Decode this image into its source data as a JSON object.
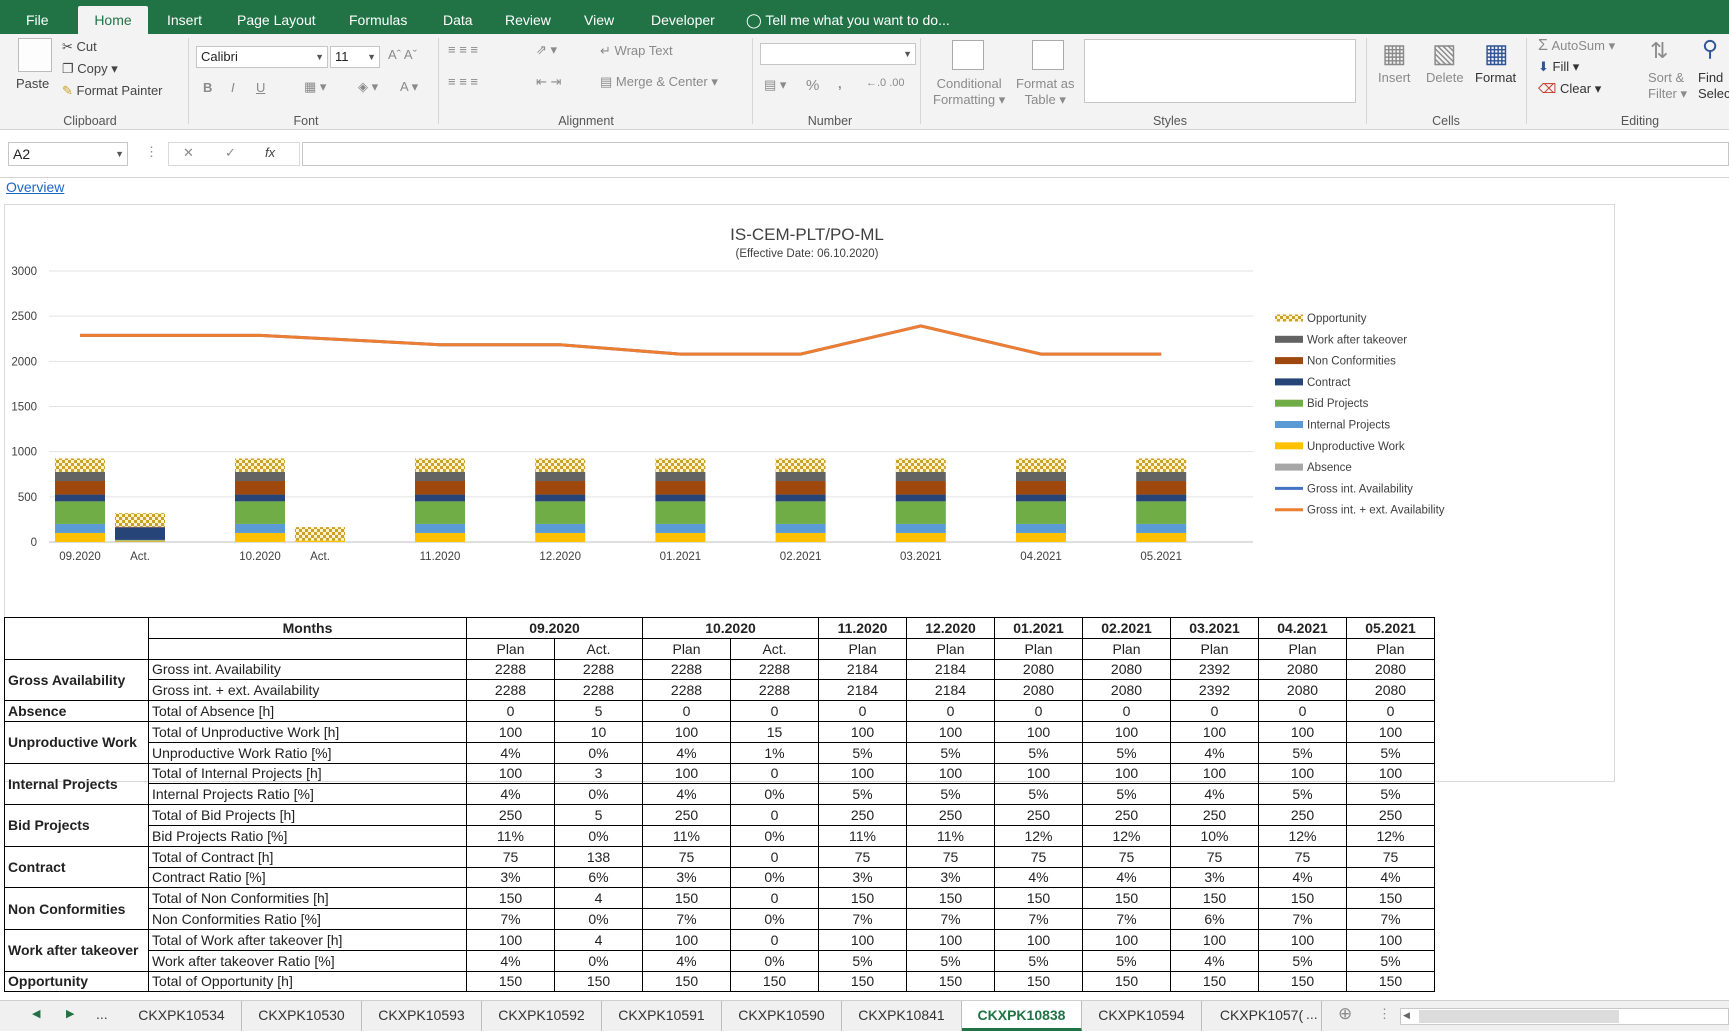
{
  "ribbon": {
    "tabs": [
      "File",
      "Home",
      "Insert",
      "Page Layout",
      "Formulas",
      "Data",
      "Review",
      "View",
      "Developer"
    ],
    "tell_me": "Tell me what you want to do...",
    "clipboard": {
      "paste": "Paste",
      "cut": "Cut",
      "copy": "Copy",
      "format_painter": "Format Painter",
      "label": "Clipboard"
    },
    "font": {
      "name": "Calibri",
      "size": "11",
      "label": "Font",
      "bold": "B",
      "italic": "I",
      "underline": "U"
    },
    "alignment": {
      "wrap": "Wrap Text",
      "merge": "Merge & Center",
      "label": "Alignment"
    },
    "number": {
      "format": "",
      "percent": "%",
      "comma": ",",
      "label": "Number"
    },
    "styles": {
      "cond1": "Conditional",
      "cond2": "Formatting",
      "fmt1": "Format as",
      "fmt2": "Table",
      "label": "Styles"
    },
    "cells": {
      "insert": "Insert",
      "delete": "Delete",
      "format": "Format",
      "label": "Cells"
    },
    "editing": {
      "autosum": "AutoSum",
      "fill": "Fill",
      "clear": "Clear",
      "sort1": "Sort &",
      "sort2": "Filter",
      "find1": "Find",
      "find2": "Selec",
      "label": "Editing"
    }
  },
  "formula": {
    "name_box": "A2",
    "fx": "fx",
    "content": ""
  },
  "sheet": {
    "link": "Overview"
  },
  "colors": {
    "accent": "#217346",
    "link": "#1e66c8"
  },
  "chart_data": {
    "type": "bar",
    "title": "IS-CEM-PLT/PO-ML",
    "subtitle": "(Effective Date: 06.10.2020)",
    "ylim": [
      0,
      3000
    ],
    "yticks": [
      0,
      500,
      1000,
      1500,
      2000,
      2500,
      3000
    ],
    "categories": [
      "09.2020",
      "Act.",
      "10.2020",
      "Act.",
      "11.2020",
      "12.2020",
      "01.2021",
      "02.2021",
      "03.2021",
      "04.2021",
      "05.2021"
    ],
    "stacked_series": [
      {
        "name": "Absence",
        "color": "#a6a6a6",
        "values": [
          0,
          5,
          0,
          0,
          0,
          0,
          0,
          0,
          0,
          0,
          0
        ]
      },
      {
        "name": "Unproductive Work",
        "color": "#ffc000",
        "values": [
          100,
          10,
          100,
          15,
          100,
          100,
          100,
          100,
          100,
          100,
          100
        ]
      },
      {
        "name": "Internal Projects",
        "color": "#5b9bd5",
        "values": [
          100,
          3,
          100,
          0,
          100,
          100,
          100,
          100,
          100,
          100,
          100
        ]
      },
      {
        "name": "Bid Projects",
        "color": "#70ad47",
        "values": [
          250,
          5,
          250,
          0,
          250,
          250,
          250,
          250,
          250,
          250,
          250
        ]
      },
      {
        "name": "Contract",
        "color": "#264478",
        "values": [
          75,
          138,
          75,
          0,
          75,
          75,
          75,
          75,
          75,
          75,
          75
        ]
      },
      {
        "name": "Non Conformities",
        "color": "#9e480e",
        "values": [
          150,
          4,
          150,
          0,
          150,
          150,
          150,
          150,
          150,
          150,
          150
        ]
      },
      {
        "name": "Work after takeover",
        "color": "#636363",
        "values": [
          100,
          4,
          100,
          0,
          100,
          100,
          100,
          100,
          100,
          100,
          100
        ]
      },
      {
        "name": "Opportunity",
        "color": "#c9a227",
        "pattern": true,
        "values": [
          150,
          150,
          150,
          150,
          150,
          150,
          150,
          150,
          150,
          150,
          150
        ]
      }
    ],
    "line_series": [
      {
        "name": "Gross int. Availability",
        "color": "#4472c4",
        "values": [
          2288,
          2288,
          2288,
          2288,
          2184,
          2184,
          2080,
          2080,
          2392,
          2080,
          2080
        ]
      },
      {
        "name": "Gross int. + ext. Availability",
        "color": "#ed7d31",
        "values": [
          2288,
          2288,
          2288,
          2288,
          2184,
          2184,
          2080,
          2080,
          2392,
          2080,
          2080
        ]
      }
    ],
    "legend_order": [
      "Opportunity",
      "Work after takeover",
      "Non Conformities",
      "Contract",
      "Bid Projects",
      "Internal Projects",
      "Unproductive Work",
      "Absence",
      "Gross int. Availability",
      "Gross int. + ext. Availability"
    ],
    "legend_position": "right",
    "grid": true
  },
  "table": {
    "months_header": "Months",
    "month_groups": [
      [
        "09.2020",
        2
      ],
      [
        "10.2020",
        2
      ],
      [
        "11.2020",
        1
      ],
      [
        "12.2020",
        1
      ],
      [
        "01.2021",
        1
      ],
      [
        "02.2021",
        1
      ],
      [
        "03.2021",
        1
      ],
      [
        "04.2021",
        1
      ],
      [
        "05.2021",
        1
      ]
    ],
    "subheaders": [
      "Plan",
      "Act.",
      "Plan",
      "Act.",
      "Plan",
      "Plan",
      "Plan",
      "Plan",
      "Plan",
      "Plan",
      "Plan"
    ],
    "groups": [
      {
        "category": "Gross Availability",
        "rows": [
          {
            "label": "Gross int. Availability",
            "values": [
              "2288",
              "2288",
              "2288",
              "2288",
              "2184",
              "2184",
              "2080",
              "2080",
              "2392",
              "2080",
              "2080"
            ]
          },
          {
            "label": "Gross int. + ext. Availability",
            "values": [
              "2288",
              "2288",
              "2288",
              "2288",
              "2184",
              "2184",
              "2080",
              "2080",
              "2392",
              "2080",
              "2080"
            ]
          }
        ]
      },
      {
        "category": "Absence",
        "rows": [
          {
            "label": "Total of Absence [h]",
            "values": [
              "0",
              "5",
              "0",
              "0",
              "0",
              "0",
              "0",
              "0",
              "0",
              "0",
              "0"
            ]
          }
        ]
      },
      {
        "category": "Unproductive Work",
        "rows": [
          {
            "label": "Total of Unproductive Work [h]",
            "values": [
              "100",
              "10",
              "100",
              "15",
              "100",
              "100",
              "100",
              "100",
              "100",
              "100",
              "100"
            ]
          },
          {
            "label": "Unproductive Work Ratio [%]",
            "values": [
              "4%",
              "0%",
              "4%",
              "1%",
              "5%",
              "5%",
              "5%",
              "5%",
              "4%",
              "5%",
              "5%"
            ]
          }
        ]
      },
      {
        "category": "Internal Projects",
        "rows": [
          {
            "label": "Total of Internal Projects [h]",
            "values": [
              "100",
              "3",
              "100",
              "0",
              "100",
              "100",
              "100",
              "100",
              "100",
              "100",
              "100"
            ]
          },
          {
            "label": "Internal Projects Ratio [%]",
            "values": [
              "4%",
              "0%",
              "4%",
              "0%",
              "5%",
              "5%",
              "5%",
              "5%",
              "4%",
              "5%",
              "5%"
            ]
          }
        ]
      },
      {
        "category": "Bid Projects",
        "rows": [
          {
            "label": "Total of Bid Projects [h]",
            "values": [
              "250",
              "5",
              "250",
              "0",
              "250",
              "250",
              "250",
              "250",
              "250",
              "250",
              "250"
            ]
          },
          {
            "label": "Bid Projects Ratio [%]",
            "values": [
              "11%",
              "0%",
              "11%",
              "0%",
              "11%",
              "11%",
              "12%",
              "12%",
              "10%",
              "12%",
              "12%"
            ]
          }
        ]
      },
      {
        "category": "Contract",
        "rows": [
          {
            "label": "Total of Contract [h]",
            "values": [
              "75",
              "138",
              "75",
              "0",
              "75",
              "75",
              "75",
              "75",
              "75",
              "75",
              "75"
            ]
          },
          {
            "label": "Contract Ratio [%]",
            "values": [
              "3%",
              "6%",
              "3%",
              "0%",
              "3%",
              "3%",
              "4%",
              "4%",
              "3%",
              "4%",
              "4%"
            ]
          }
        ]
      },
      {
        "category": "Non Conformities",
        "rows": [
          {
            "label": "Total of Non Conformities [h]",
            "values": [
              "150",
              "4",
              "150",
              "0",
              "150",
              "150",
              "150",
              "150",
              "150",
              "150",
              "150"
            ]
          },
          {
            "label": "Non Conformities Ratio [%]",
            "values": [
              "7%",
              "0%",
              "7%",
              "0%",
              "7%",
              "7%",
              "7%",
              "7%",
              "6%",
              "7%",
              "7%"
            ]
          }
        ]
      },
      {
        "category": "Work after takeover",
        "rows": [
          {
            "label": "Total of Work after takeover [h]",
            "values": [
              "100",
              "4",
              "100",
              "0",
              "100",
              "100",
              "100",
              "100",
              "100",
              "100",
              "100"
            ]
          },
          {
            "label": "Work after takeover Ratio [%]",
            "values": [
              "4%",
              "0%",
              "4%",
              "0%",
              "5%",
              "5%",
              "5%",
              "5%",
              "4%",
              "5%",
              "5%"
            ]
          }
        ]
      },
      {
        "category": "Opportunity",
        "rows": [
          {
            "label": "Total of Opportunity [h]",
            "values": [
              "150",
              "150",
              "150",
              "150",
              "150",
              "150",
              "150",
              "150",
              "150",
              "150",
              "150"
            ]
          }
        ]
      }
    ]
  },
  "sheet_tabs": [
    "CKXPK10534",
    "CKXPK10530",
    "CKXPK10593",
    "CKXPK10592",
    "CKXPK10591",
    "CKXPK10590",
    "CKXPK10841",
    "CKXPK10838",
    "CKXPK10594",
    "CKXPK1057("
  ],
  "active_tab": "CKXPK10838",
  "tab_overflow": "...",
  "tab_overflow_right": "..."
}
